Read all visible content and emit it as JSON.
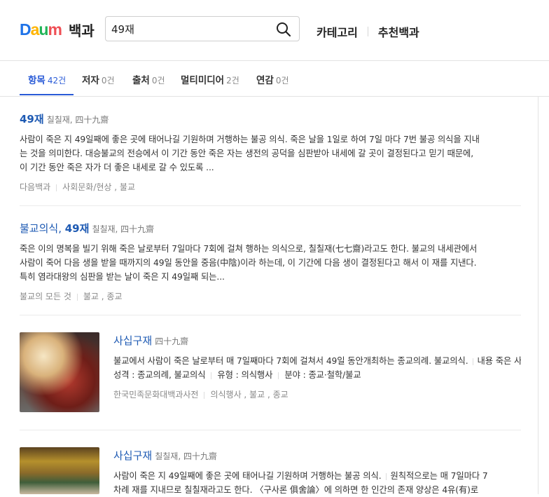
{
  "header": {
    "logo_text": "Daum",
    "logo_title": "백과",
    "search_value": "49재",
    "nav": [
      "카테고리",
      "추천백과"
    ]
  },
  "tabs": [
    {
      "label": "항목",
      "count": "42건",
      "active": true
    },
    {
      "label": "저자",
      "count": "0건"
    },
    {
      "label": "출처",
      "count": "0건"
    },
    {
      "label": "멀티미디어",
      "count": "2건"
    },
    {
      "label": "연감",
      "count": "0건"
    }
  ],
  "results": [
    {
      "title": "49재",
      "subtitle": "칠칠재, 四十九齋",
      "lines": [
        "사람이 죽은 지 49일째에 좋은 곳에 태어나길 기원하며 거행하는 불공 의식. 죽은 날을 1일로 하여 7일 마다 7번 불공 의식을 지내",
        "는 것을 의미한다. 대승불교의 전승에서 이 기간 동안 죽은 자는 생전의 공덕을 심판받아 내세에 갈 곳이 결정된다고 믿기 때문에,",
        "이 기간 동안 죽은 자가 더 좋은 내세로 갈 수 있도록 ..."
      ],
      "source": "다음백과",
      "category": "사회문화/현상 , 불교"
    },
    {
      "title_prefix": "불교의식,",
      "title": "49재",
      "subtitle": "칠칠재, 四十九齋",
      "lines": [
        "죽은 이의 명복을 빌기 위해 죽은 날로부터 7일마다 7회에 걸쳐 행하는 의식으로, 칠칠재(七七齋)라고도 한다. 불교의 내세관에서",
        "사람이 죽어 다음 생을 받을 때까지의 49일 동안을 중음(中陰)이라 하는데, 이 기간에 다음 생이 결정된다고 해서 이 재를 지낸다.",
        "특히 염라대왕의 심판을 받는 날이 죽은 지 49일째 되는..."
      ],
      "source": "불교의 모든 것",
      "category": "불교 , 종교"
    },
    {
      "title": "사십구재",
      "subtitle": "四十九齋",
      "lines": [
        "불교에서 사람이 죽은 날로부터 매 7일째마다 7회에 걸쳐서 49일 동안개최하는 종교의례. 불교의식.",
        "내용 죽은 사람의 명복을 비는 천도(薦度 : 죽은 영혼이 좋은 곳에 태어나도록 기도함)의식이다. ‘칠칠일(七",
        "성격 : 종교의례, 불교의식",
        "유형 : 의식행사",
        "분야 : 종교·철학/불교"
      ],
      "source": "한국민족문화대백과사전",
      "category": "의식행사 , 불교 , 종교"
    },
    {
      "title": "사십구재",
      "subtitle": "칠칠재, 四十九齋",
      "lines": [
        "사람이 죽은 지 49일째에 좋은 곳에 태어나길 기원하며 거행하는 불공 의식.",
        "원칙적으로는 매 7일마다 7",
        "차례 재를 지내므로 칠칠재라고도 한다. 〈구사론 俱舍論〉에 의하면 한 인간의 존재 양상은 4유(有)로"
      ]
    }
  ]
}
